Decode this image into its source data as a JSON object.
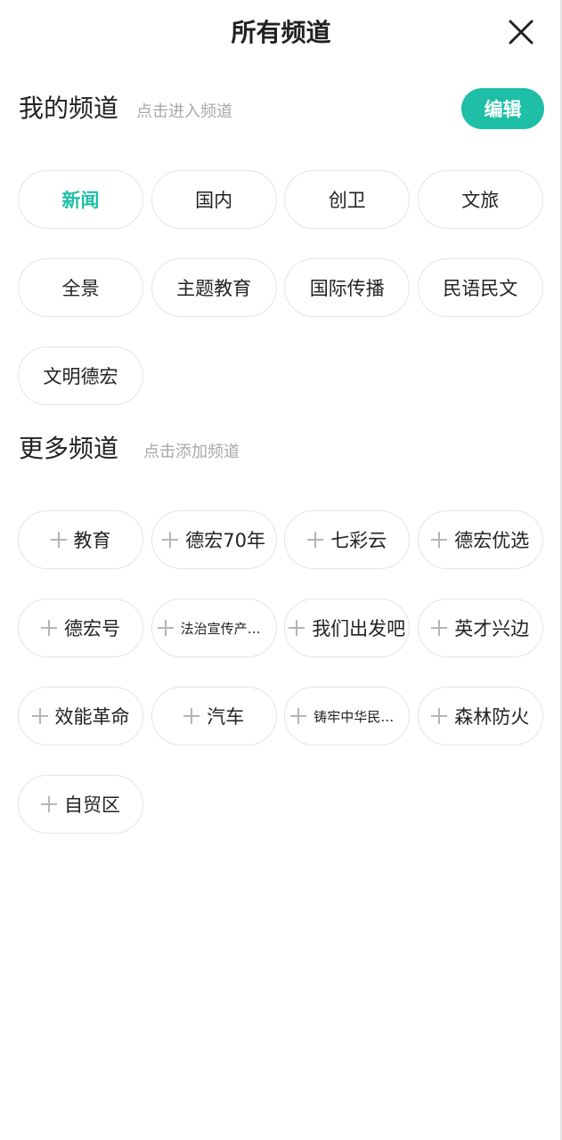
{
  "header": {
    "title": "所有频道",
    "close_icon": "close-icon"
  },
  "my_channels": {
    "title": "我的频道",
    "hint": "点击进入频道",
    "edit_label": "编辑",
    "accent_color": "#1fbea6",
    "items": [
      {
        "label": "新闻",
        "active": true
      },
      {
        "label": "国内"
      },
      {
        "label": "创卫"
      },
      {
        "label": "文旅"
      },
      {
        "label": "全景"
      },
      {
        "label": "主题教育"
      },
      {
        "label": "国际传播"
      },
      {
        "label": "民语民文"
      },
      {
        "label": "文明德宏"
      }
    ]
  },
  "more_channels": {
    "title": "更多频道",
    "hint": "点击添加频道",
    "add_icon": "plus-icon",
    "items": [
      {
        "label": "教育"
      },
      {
        "label": "德宏70年"
      },
      {
        "label": "七彩云"
      },
      {
        "label": "德宏优选"
      },
      {
        "label": "德宏号"
      },
      {
        "label": "法治宣传产品...",
        "small": true
      },
      {
        "label": "我们出发吧"
      },
      {
        "label": "英才兴边"
      },
      {
        "label": "效能革命"
      },
      {
        "label": "汽车"
      },
      {
        "label": "铸牢中华民族...",
        "small": true
      },
      {
        "label": "森林防火"
      },
      {
        "label": "自贸区"
      }
    ]
  }
}
